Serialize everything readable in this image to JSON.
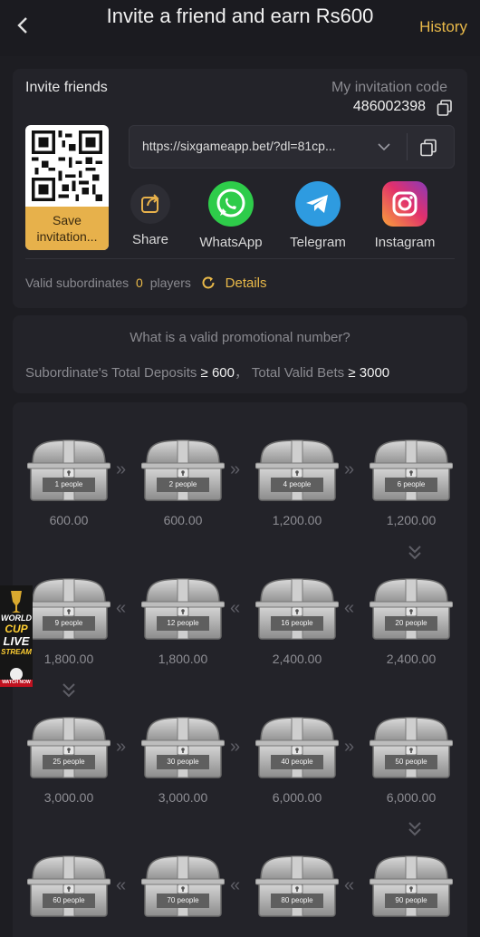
{
  "header": {
    "title": "Invite a friend and earn Rs600",
    "history": "History"
  },
  "invite": {
    "label": "Invite friends",
    "code_label": "My invitation code",
    "code": "486002398",
    "save_label": "Save invitation...",
    "link": "https://sixgameapp.bet/?dl=81cp..."
  },
  "share": [
    {
      "label": "Share",
      "icon": "share-icon",
      "color": "#2d2d34"
    },
    {
      "label": "WhatsApp",
      "icon": "whatsapp-icon",
      "color": "#2ecc4a"
    },
    {
      "label": "Telegram",
      "icon": "telegram-icon",
      "color": "#2e9be0"
    },
    {
      "label": "Instagram",
      "icon": "instagram-icon",
      "color": "#e1306c"
    }
  ],
  "valid": {
    "label": "Valid subordinates",
    "count": "0",
    "unit": "players",
    "details": "Details"
  },
  "promo_info": {
    "question": "What is a valid promotional number?",
    "deposit_label": "Subordinate's Total Deposits",
    "ge1": "≥ 600",
    "sep": "，",
    "bets_label": "Total Valid Bets",
    "ge2": "≥ 3000"
  },
  "rewards": [
    {
      "people": "1 people",
      "amount": "600.00"
    },
    {
      "people": "2 people",
      "amount": "600.00"
    },
    {
      "people": "4 people",
      "amount": "1,200.00"
    },
    {
      "people": "6 people",
      "amount": "1,200.00"
    },
    {
      "people": "20 people",
      "amount": "2,400.00"
    },
    {
      "people": "16 people",
      "amount": "2,400.00"
    },
    {
      "people": "12 people",
      "amount": "1,800.00"
    },
    {
      "people": "9 people",
      "amount": "1,800.00"
    },
    {
      "people": "25 people",
      "amount": "3,000.00"
    },
    {
      "people": "30 people",
      "amount": "3,000.00"
    },
    {
      "people": "40 people",
      "amount": "6,000.00"
    },
    {
      "people": "50 people",
      "amount": "6,000.00"
    },
    {
      "people": "90 people",
      "amount": ""
    },
    {
      "people": "80 people",
      "amount": ""
    },
    {
      "people": "70 people",
      "amount": ""
    },
    {
      "people": "60 people",
      "amount": ""
    }
  ],
  "promo_badge": {
    "l1": "WORLD",
    "l2": "CUP",
    "l3": "LIVE",
    "l4": "STREAM",
    "l5": "WATCH NOW"
  },
  "colors": {
    "accent": "#e9b949",
    "background": "#1d1d22",
    "card": "#232329"
  }
}
